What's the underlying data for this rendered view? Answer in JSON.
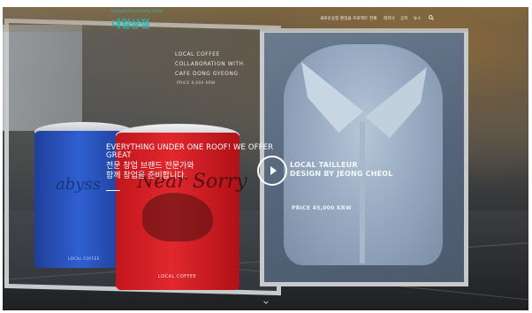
{
  "brand": {
    "small": "hangeulenjoy.my.shop",
    "name": "내일상점",
    "color": "#21b5b1"
  },
  "nav": {
    "items": [
      "새로운상점",
      "편집숍 프로젝트",
      "연재",
      "레지너",
      "공지",
      "뉴스"
    ]
  },
  "hero": {
    "left_caption": [
      "LOCAL COFFEE",
      "COLLABORATION WITH",
      "CAFE DONG GYEONG"
    ],
    "left_price": "PRICE 9,000 KRW",
    "headline": "EVERYTHING UNDER ONE ROOF! WE OFFER GREAT",
    "korean_lines": [
      "전문 창업 브랜드 전문가와",
      "함께 창업을 준비합니다."
    ],
    "right_caption": [
      "LOCAL TAILLEUR",
      "DESIGN BY JEONG CHEOL"
    ],
    "right_price": "PRICE 45,000 KRW"
  },
  "cans": {
    "red_script": "Near Sorry",
    "blue_script": "abyss",
    "red_label": "LOCAL COFFEE",
    "blue_label": "LOCAL COFFEE"
  },
  "icons": {
    "search": "search-icon",
    "play": "play-icon",
    "scroll": "chevron-down-icon"
  }
}
